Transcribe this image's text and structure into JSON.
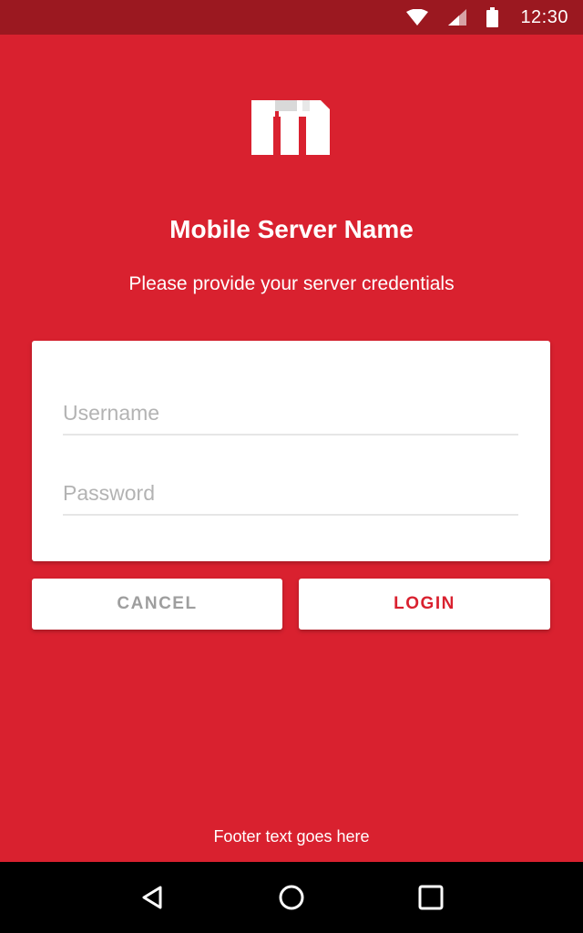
{
  "status_bar": {
    "time": "12:30",
    "icons": [
      "wifi-icon",
      "signal-icon",
      "battery-icon"
    ]
  },
  "app": {
    "logo": "m-logo",
    "title": "Mobile Server Name",
    "subtitle": "Please provide your server credentials"
  },
  "form": {
    "username": {
      "value": "",
      "placeholder": "Username"
    },
    "password": {
      "value": "",
      "placeholder": "Password"
    }
  },
  "buttons": {
    "cancel_label": "CANCEL",
    "login_label": "LOGIN"
  },
  "footer": {
    "text": "Footer text goes here"
  },
  "nav_bar": {
    "icons": [
      "back-icon",
      "home-icon",
      "recents-icon"
    ]
  },
  "colors": {
    "background": "#d9212f",
    "status_bar": "#9b1820",
    "accent": "#d9212f",
    "cancel_text": "#9e9e9e"
  }
}
